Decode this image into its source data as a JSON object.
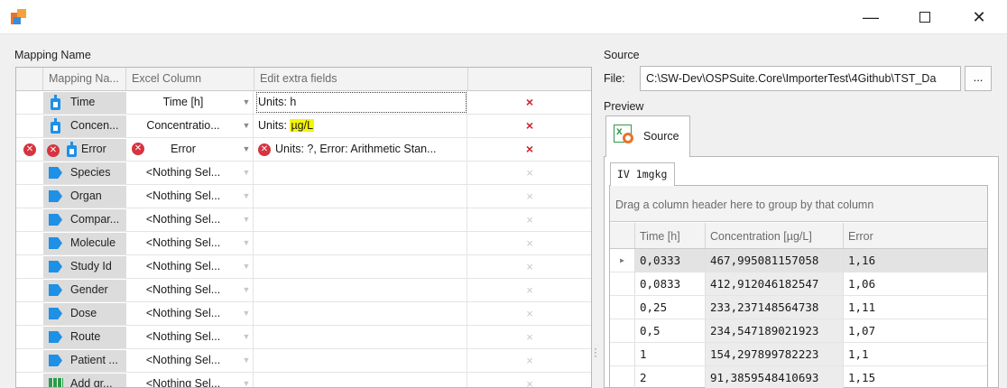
{
  "window": {
    "minimize": "—",
    "close": "✕"
  },
  "mapping": {
    "label": "Mapping Name",
    "headers": [
      "Mapping Na...",
      "Excel Column",
      "Edit extra fields"
    ],
    "rows": [
      {
        "icon": "drop",
        "name": "Time",
        "excel": "Time [h]",
        "extra_pre": "Units: h",
        "extra_hl": "",
        "delete": "×",
        "active": true
      },
      {
        "icon": "drop",
        "name": "Concen...",
        "excel": "Concentratio...",
        "extra_pre": "Units: ",
        "extra_hl": "µg/L",
        "delete": "×",
        "active": true
      },
      {
        "icon": "drop",
        "name": "Error",
        "excel": "Error",
        "extra_pre": "Units: ?, Error: Arithmetic Stan...",
        "extra_hl": "",
        "delete": "×",
        "active": true,
        "error": true
      },
      {
        "icon": "tag",
        "name": "Species",
        "excel": "<Nothing Sel...",
        "delete": "×"
      },
      {
        "icon": "tag",
        "name": "Organ",
        "excel": "<Nothing Sel...",
        "delete": "×"
      },
      {
        "icon": "tag",
        "name": "Compar...",
        "excel": "<Nothing Sel...",
        "delete": "×"
      },
      {
        "icon": "tag",
        "name": "Molecule",
        "excel": "<Nothing Sel...",
        "delete": "×"
      },
      {
        "icon": "tag",
        "name": "Study Id",
        "excel": "<Nothing Sel...",
        "delete": "×"
      },
      {
        "icon": "tag",
        "name": "Gender",
        "excel": "<Nothing Sel...",
        "delete": "×"
      },
      {
        "icon": "tag",
        "name": "Dose",
        "excel": "<Nothing Sel...",
        "delete": "×"
      },
      {
        "icon": "tag",
        "name": "Route",
        "excel": "<Nothing Sel...",
        "delete": "×"
      },
      {
        "icon": "tag",
        "name": "Patient ...",
        "excel": "<Nothing Sel...",
        "delete": "×"
      },
      {
        "icon": "grid",
        "name": "Add gr...",
        "excel": "<Nothing Sel...",
        "delete": "×"
      }
    ]
  },
  "source": {
    "label": "Source",
    "file_label": "File:",
    "file_path": "C:\\SW-Dev\\OSPSuite.Core\\ImporterTest\\4Github\\TST_Da",
    "browse": "...",
    "preview_label": "Preview",
    "tab": "Source",
    "sheet": "IV 1mgkg",
    "group_hint": "Drag a column header here to group by that column",
    "columns": [
      "Time [h]",
      "Concentration [µg/L]",
      "Error"
    ],
    "rows": [
      [
        "0,0333",
        "467,995081157058",
        "1,16"
      ],
      [
        "0,0833",
        "412,912046182547",
        "1,06"
      ],
      [
        "0,25",
        "233,237148564738",
        "1,11"
      ],
      [
        "0,5",
        "234,547189021923",
        "1,07"
      ],
      [
        "1",
        "154,297899782223",
        "1,1"
      ],
      [
        "2",
        "91,3859548410693",
        "1,15"
      ]
    ]
  },
  "colors": {
    "accent": "#1e90e6",
    "error": "#d63440",
    "highlight": "#f7f500",
    "excel_green": "#2d9a48"
  }
}
